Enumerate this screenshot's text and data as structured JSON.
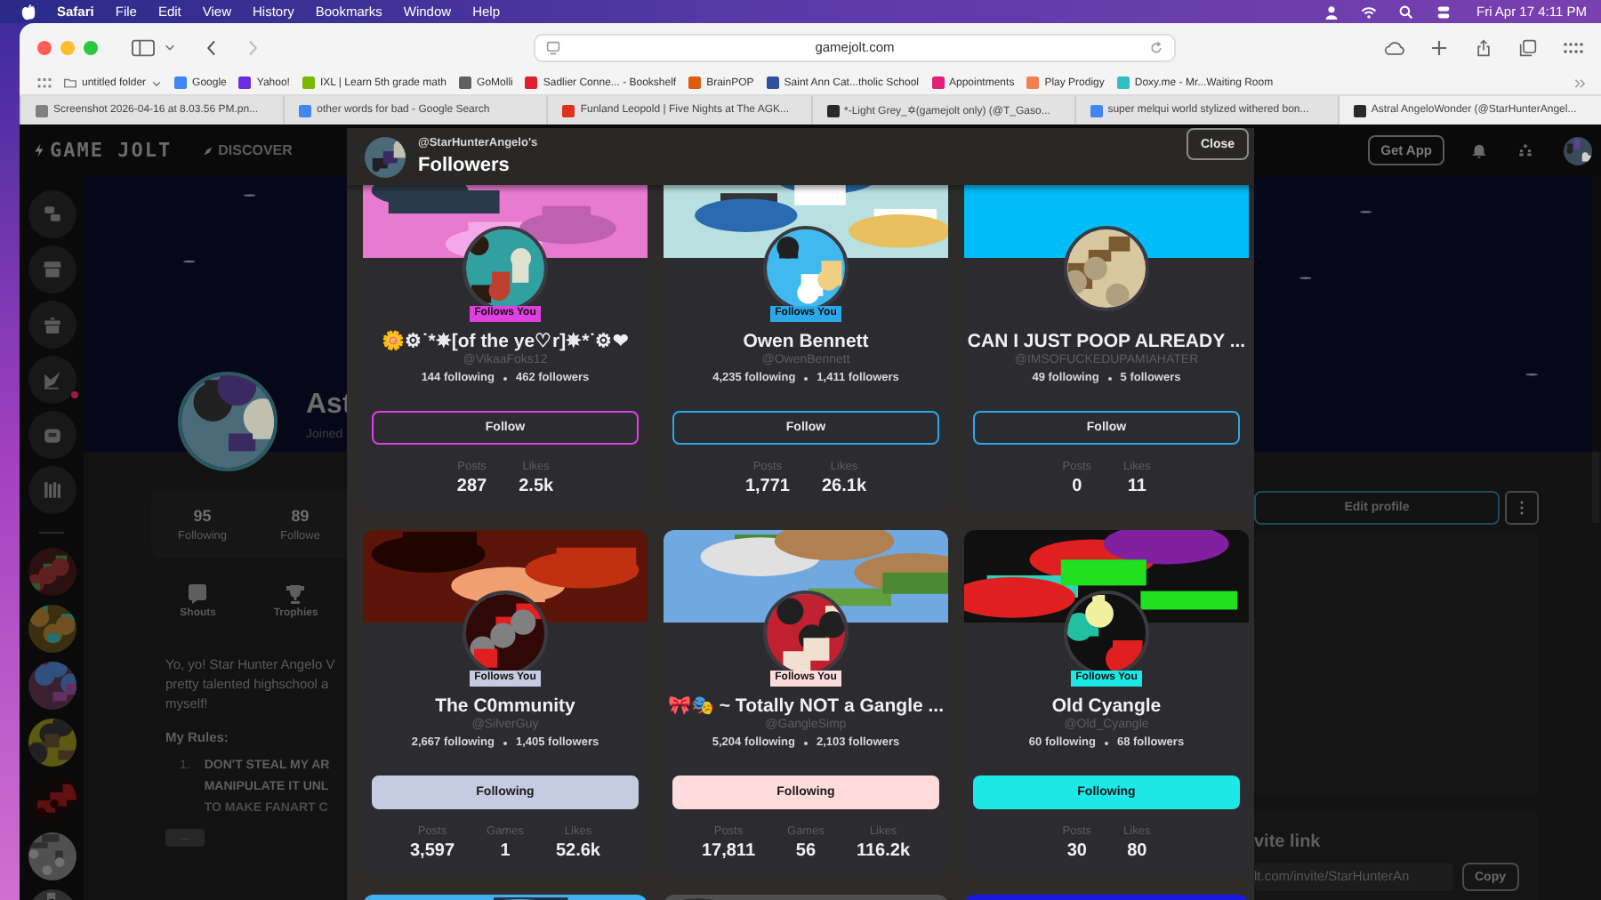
{
  "menubar": {
    "app": "Safari",
    "menus": [
      "File",
      "Edit",
      "View",
      "History",
      "Bookmarks",
      "Window",
      "Help"
    ],
    "clock": "Fri Apr 17  4:11 PM"
  },
  "browser": {
    "url": "gamejolt.com",
    "bookmarks": [
      {
        "label": "untitled folder",
        "kind": "folder",
        "color": "#808080"
      },
      {
        "label": "Google",
        "kind": "site",
        "color": "#4285f4"
      },
      {
        "label": "Yahoo!",
        "kind": "site",
        "color": "#6a2de0"
      },
      {
        "label": "IXL | Learn 5th grade math",
        "kind": "site",
        "color": "#7ab800"
      },
      {
        "label": "GoMolli",
        "kind": "site",
        "color": "#606060"
      },
      {
        "label": "Sadlier Conne... - Bookshelf",
        "kind": "site",
        "color": "#e02030"
      },
      {
        "label": "BrainPOP",
        "kind": "site",
        "color": "#e05a10"
      },
      {
        "label": "Saint Ann Cat...tholic School",
        "kind": "site",
        "color": "#3050a0"
      },
      {
        "label": "Appointments",
        "kind": "site",
        "color": "#e0207a"
      },
      {
        "label": "Play Prodigy",
        "kind": "site",
        "color": "#f08050"
      },
      {
        "label": "Doxy.me - Mr...Waiting Room",
        "kind": "site",
        "color": "#30c0c0"
      }
    ],
    "tabs": [
      {
        "label": "Screenshot 2026-04-16 at 8.03.56 PM.pn...",
        "color": "#808080",
        "selected": false
      },
      {
        "label": "other words for bad - Google Search",
        "color": "#4285f4",
        "selected": false
      },
      {
        "label": "Funland Leopold | Five Nights at The AGK...",
        "color": "#e03020",
        "selected": false
      },
      {
        "label": "*-Light Grey_✡(gamejolt only) (@T_Gaso...",
        "color": "#2a2a2a",
        "selected": false
      },
      {
        "label": "super melqui world stylized withered bon...",
        "color": "#4285f4",
        "selected": false
      },
      {
        "label": "Astral AngeloWonder (@StarHunterAngel...",
        "color": "#2a2a2a",
        "selected": true
      }
    ]
  },
  "site": {
    "logo": "GAME JOLT",
    "nav": [
      "DISCOVER"
    ],
    "get_app": "Get App",
    "shortcuts": [
      {
        "kind": "chat",
        "badge": false
      },
      {
        "kind": "store",
        "badge": false
      },
      {
        "kind": "gift",
        "badge": false
      },
      {
        "kind": "quill",
        "badge": true
      },
      {
        "kind": "bot",
        "badge": false
      },
      {
        "kind": "library",
        "badge": false
      }
    ]
  },
  "profile": {
    "name": "Ast",
    "joined": "Joined",
    "stats": [
      {
        "value": "95",
        "label": "Following"
      },
      {
        "value": "89",
        "label": "Followe"
      }
    ],
    "sections": [
      {
        "label": "Shouts",
        "kind": "shouts"
      },
      {
        "label": "Trophies",
        "kind": "trophies"
      }
    ],
    "bio": [
      "Yo, yo! Star Hunter Angelo V",
      "pretty talented highschool a",
      "myself!"
    ],
    "rules_title": "My Rules:",
    "rules": [
      {
        "number": "1.",
        "lines": [
          "DON'T STEAL MY AR",
          "MANIPULATE IT UNL",
          "TO MAKE FANART C"
        ]
      }
    ],
    "more": "...",
    "edit": "Edit profile",
    "invite": {
      "title": "vite link",
      "url": "lt.com/invite/StarHunterAn",
      "copy": "Copy"
    }
  },
  "modal": {
    "owner": "@StarHunterAngelo's",
    "title": "Followers",
    "close": "Close",
    "cards": [
      {
        "name": "🌼⚙˙*✵[of the ye♡r]✵*˙⚙❤",
        "handle": "@VikaaFoks12",
        "following_count": "144 following",
        "followers_count": "462 followers",
        "badge": "Follows You",
        "color": "#e040e0",
        "following": false,
        "button": "Follow",
        "stats": [
          {
            "label": "Posts",
            "value": "287"
          },
          {
            "label": "Likes",
            "value": "2.5k"
          }
        ]
      },
      {
        "name": "Owen Bennett",
        "handle": "@OwenBennett",
        "following_count": "4,235 following",
        "followers_count": "1,411 followers",
        "badge": "Follows You",
        "color": "#2aa8e8",
        "following": false,
        "button": "Follow",
        "stats": [
          {
            "label": "Posts",
            "value": "1,771"
          },
          {
            "label": "Likes",
            "value": "26.1k"
          }
        ]
      },
      {
        "name": "CAN I JUST POOP ALREADY ...",
        "handle": "@IMSOFUCKEDUPAMIAHATER",
        "following_count": "49 following",
        "followers_count": "5 followers",
        "color": "#2aa8e8",
        "following": false,
        "button": "Follow",
        "stats": [
          {
            "label": "Posts",
            "value": "0"
          },
          {
            "label": "Likes",
            "value": "11"
          }
        ]
      },
      {
        "name": "The C0mmunity",
        "handle": "@SilverGuy",
        "following_count": "2,667 following",
        "followers_count": "1,405 followers",
        "badge": "Follows You",
        "color": "#c5cbe0",
        "following": true,
        "button": "Following",
        "stats": [
          {
            "label": "Posts",
            "value": "3,597"
          },
          {
            "label": "Games",
            "value": "1"
          },
          {
            "label": "Likes",
            "value": "52.6k"
          }
        ]
      },
      {
        "name": "🎀🎭 ~ Totally NOT a Gangle ...",
        "handle": "@GangleSimp",
        "following_count": "5,204 following",
        "followers_count": "2,103 followers",
        "badge": "Follows You",
        "color": "#ffdcdc",
        "following": true,
        "button": "Following",
        "stats": [
          {
            "label": "Posts",
            "value": "17,811"
          },
          {
            "label": "Games",
            "value": "56"
          },
          {
            "label": "Likes",
            "value": "116.2k"
          }
        ]
      },
      {
        "name": "Old Cyangle",
        "handle": "@Old_Cyangle",
        "following_count": "60 following",
        "followers_count": "68 followers",
        "badge": "Follows You",
        "color": "#1ce8e8",
        "following": true,
        "button": "Following",
        "stats": [
          {
            "label": "Posts",
            "value": "30"
          },
          {
            "label": "Likes",
            "value": "80"
          }
        ]
      }
    ]
  }
}
